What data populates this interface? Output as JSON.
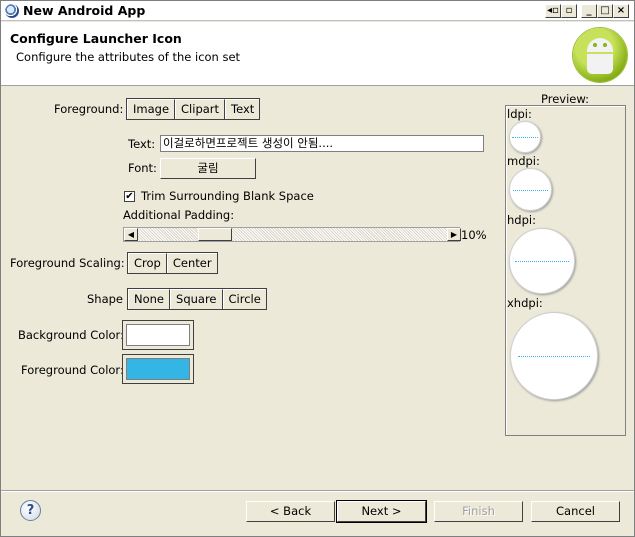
{
  "window": {
    "title": "New Android App"
  },
  "header": {
    "title": "Configure Launcher Icon",
    "subtitle": "Configure the attributes of the icon set"
  },
  "form": {
    "foreground_label": "Foreground:",
    "foreground_options": [
      "Image",
      "Clipart",
      "Text"
    ],
    "text_label": "Text:",
    "text_value": "이걸로하면프로젝트 생성이 안됨....",
    "font_label": "Font:",
    "font_value": "굴림",
    "trim_label": "Trim Surrounding Blank Space",
    "trim_checked": true,
    "padding_label": "Additional Padding:",
    "padding_value": "10%",
    "scaling_label": "Foreground Scaling:",
    "scaling_options": [
      "Crop",
      "Center"
    ],
    "shape_label": "Shape",
    "shape_options": [
      "None",
      "Square",
      "Circle"
    ],
    "background_color_label": "Background Color:",
    "background_color": "#ffffff",
    "foreground_color_label": "Foreground Color:",
    "foreground_color": "#33b5e5"
  },
  "preview": {
    "title": "Preview:",
    "densities": [
      "ldpi:",
      "mdpi:",
      "hdpi:",
      "xhdpi:"
    ]
  },
  "buttons": {
    "back": "< Back",
    "next": "Next >",
    "finish": "Finish",
    "cancel": "Cancel",
    "help": "?"
  },
  "window_controls": {
    "restore": "◂▫",
    "restore2": "▫",
    "minimize": "_",
    "maximize": "□",
    "close": "×"
  }
}
